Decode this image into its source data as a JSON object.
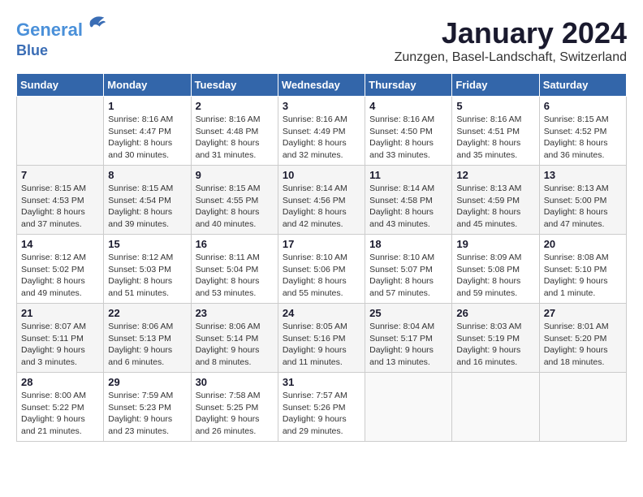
{
  "header": {
    "logo_line1": "General",
    "logo_line2": "Blue",
    "title": "January 2024",
    "subtitle": "Zunzgen, Basel-Landschaft, Switzerland"
  },
  "days_of_week": [
    "Sunday",
    "Monday",
    "Tuesday",
    "Wednesday",
    "Thursday",
    "Friday",
    "Saturday"
  ],
  "weeks": [
    [
      {
        "day": "",
        "info": ""
      },
      {
        "day": "1",
        "info": "Sunrise: 8:16 AM\nSunset: 4:47 PM\nDaylight: 8 hours\nand 30 minutes."
      },
      {
        "day": "2",
        "info": "Sunrise: 8:16 AM\nSunset: 4:48 PM\nDaylight: 8 hours\nand 31 minutes."
      },
      {
        "day": "3",
        "info": "Sunrise: 8:16 AM\nSunset: 4:49 PM\nDaylight: 8 hours\nand 32 minutes."
      },
      {
        "day": "4",
        "info": "Sunrise: 8:16 AM\nSunset: 4:50 PM\nDaylight: 8 hours\nand 33 minutes."
      },
      {
        "day": "5",
        "info": "Sunrise: 8:16 AM\nSunset: 4:51 PM\nDaylight: 8 hours\nand 35 minutes."
      },
      {
        "day": "6",
        "info": "Sunrise: 8:15 AM\nSunset: 4:52 PM\nDaylight: 8 hours\nand 36 minutes."
      }
    ],
    [
      {
        "day": "7",
        "info": "Sunrise: 8:15 AM\nSunset: 4:53 PM\nDaylight: 8 hours\nand 37 minutes."
      },
      {
        "day": "8",
        "info": "Sunrise: 8:15 AM\nSunset: 4:54 PM\nDaylight: 8 hours\nand 39 minutes."
      },
      {
        "day": "9",
        "info": "Sunrise: 8:15 AM\nSunset: 4:55 PM\nDaylight: 8 hours\nand 40 minutes."
      },
      {
        "day": "10",
        "info": "Sunrise: 8:14 AM\nSunset: 4:56 PM\nDaylight: 8 hours\nand 42 minutes."
      },
      {
        "day": "11",
        "info": "Sunrise: 8:14 AM\nSunset: 4:58 PM\nDaylight: 8 hours\nand 43 minutes."
      },
      {
        "day": "12",
        "info": "Sunrise: 8:13 AM\nSunset: 4:59 PM\nDaylight: 8 hours\nand 45 minutes."
      },
      {
        "day": "13",
        "info": "Sunrise: 8:13 AM\nSunset: 5:00 PM\nDaylight: 8 hours\nand 47 minutes."
      }
    ],
    [
      {
        "day": "14",
        "info": "Sunrise: 8:12 AM\nSunset: 5:02 PM\nDaylight: 8 hours\nand 49 minutes."
      },
      {
        "day": "15",
        "info": "Sunrise: 8:12 AM\nSunset: 5:03 PM\nDaylight: 8 hours\nand 51 minutes."
      },
      {
        "day": "16",
        "info": "Sunrise: 8:11 AM\nSunset: 5:04 PM\nDaylight: 8 hours\nand 53 minutes."
      },
      {
        "day": "17",
        "info": "Sunrise: 8:10 AM\nSunset: 5:06 PM\nDaylight: 8 hours\nand 55 minutes."
      },
      {
        "day": "18",
        "info": "Sunrise: 8:10 AM\nSunset: 5:07 PM\nDaylight: 8 hours\nand 57 minutes."
      },
      {
        "day": "19",
        "info": "Sunrise: 8:09 AM\nSunset: 5:08 PM\nDaylight: 8 hours\nand 59 minutes."
      },
      {
        "day": "20",
        "info": "Sunrise: 8:08 AM\nSunset: 5:10 PM\nDaylight: 9 hours\nand 1 minute."
      }
    ],
    [
      {
        "day": "21",
        "info": "Sunrise: 8:07 AM\nSunset: 5:11 PM\nDaylight: 9 hours\nand 3 minutes."
      },
      {
        "day": "22",
        "info": "Sunrise: 8:06 AM\nSunset: 5:13 PM\nDaylight: 9 hours\nand 6 minutes."
      },
      {
        "day": "23",
        "info": "Sunrise: 8:06 AM\nSunset: 5:14 PM\nDaylight: 9 hours\nand 8 minutes."
      },
      {
        "day": "24",
        "info": "Sunrise: 8:05 AM\nSunset: 5:16 PM\nDaylight: 9 hours\nand 11 minutes."
      },
      {
        "day": "25",
        "info": "Sunrise: 8:04 AM\nSunset: 5:17 PM\nDaylight: 9 hours\nand 13 minutes."
      },
      {
        "day": "26",
        "info": "Sunrise: 8:03 AM\nSunset: 5:19 PM\nDaylight: 9 hours\nand 16 minutes."
      },
      {
        "day": "27",
        "info": "Sunrise: 8:01 AM\nSunset: 5:20 PM\nDaylight: 9 hours\nand 18 minutes."
      }
    ],
    [
      {
        "day": "28",
        "info": "Sunrise: 8:00 AM\nSunset: 5:22 PM\nDaylight: 9 hours\nand 21 minutes."
      },
      {
        "day": "29",
        "info": "Sunrise: 7:59 AM\nSunset: 5:23 PM\nDaylight: 9 hours\nand 23 minutes."
      },
      {
        "day": "30",
        "info": "Sunrise: 7:58 AM\nSunset: 5:25 PM\nDaylight: 9 hours\nand 26 minutes."
      },
      {
        "day": "31",
        "info": "Sunrise: 7:57 AM\nSunset: 5:26 PM\nDaylight: 9 hours\nand 29 minutes."
      },
      {
        "day": "",
        "info": ""
      },
      {
        "day": "",
        "info": ""
      },
      {
        "day": "",
        "info": ""
      }
    ]
  ]
}
